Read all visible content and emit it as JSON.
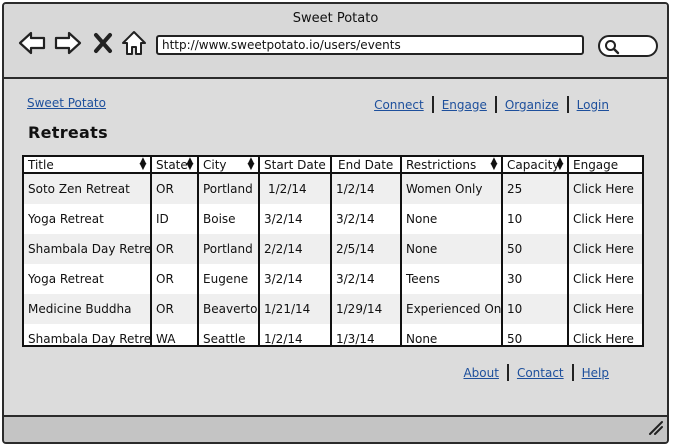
{
  "window": {
    "title": "Sweet Potato"
  },
  "browser": {
    "url": "http://www.sweetpotato.io/users/events"
  },
  "header": {
    "brand": "Sweet Potato",
    "nav": [
      "Connect",
      "Engage",
      "Organize",
      "Login"
    ]
  },
  "page": {
    "title": "Retreats"
  },
  "table": {
    "columns": [
      "Title",
      "State",
      "City",
      "Start Date",
      "End Date",
      "Restrictions",
      "Capacity",
      "Engage"
    ],
    "rows": [
      [
        "Soto Zen Retreat",
        "OR",
        "Portland",
        "1/2/14",
        "1/2/14",
        "Women Only",
        "25",
        "Click Here"
      ],
      [
        "Yoga Retreat",
        "ID",
        "Boise",
        "3/2/14",
        "3/2/14",
        "None",
        "10",
        "Click Here"
      ],
      [
        "Shambala Day Retreat",
        "OR",
        "Portland",
        "2/2/14",
        "2/5/14",
        "None",
        "50",
        "Click Here"
      ],
      [
        "Yoga Retreat",
        "OR",
        "Eugene",
        "3/2/14",
        "3/2/14",
        "Teens",
        "30",
        "Click Here"
      ],
      [
        "Medicine Buddha",
        "OR",
        "Beaverton",
        "1/21/14",
        "1/29/14",
        "Experienced Only",
        "10",
        "Click Here"
      ],
      [
        "Shambala Day Retreat",
        "WA",
        "Seattle",
        "1/2/14",
        "1/3/14",
        "None",
        "50",
        "Click Here"
      ]
    ]
  },
  "footer": {
    "links": [
      "About",
      "Contact",
      "Help"
    ]
  }
}
